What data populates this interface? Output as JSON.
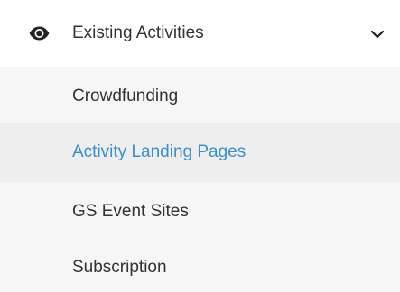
{
  "nav": {
    "section": {
      "title": "Existing Activities",
      "icon": "eye-icon",
      "expand_icon": "chevron-down-icon",
      "expanded": true
    },
    "items": [
      {
        "label": "Crowdfunding",
        "active": false
      },
      {
        "label": "Activity Landing Pages",
        "active": true
      },
      {
        "label": "GS Event Sites",
        "active": false
      },
      {
        "label": "Subscription",
        "active": false
      }
    ]
  },
  "colors": {
    "text": "#333333",
    "active_text": "#3b8fce",
    "submenu_bg": "#f6f6f6",
    "active_bg": "#eeeeee"
  }
}
